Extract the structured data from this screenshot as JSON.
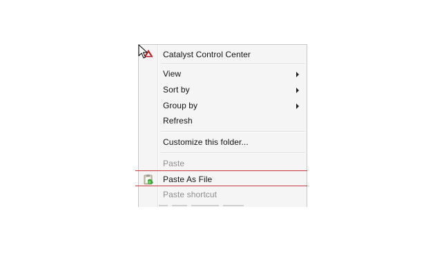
{
  "menu": {
    "items": [
      {
        "label": "Catalyst Control Center",
        "icon": "catalyst-control-center-icon"
      },
      {
        "label": "View",
        "submenu": true
      },
      {
        "label": "Sort by",
        "submenu": true
      },
      {
        "label": "Group by",
        "submenu": true
      },
      {
        "label": "Refresh"
      },
      {
        "label": "Customize this folder..."
      },
      {
        "label": "Paste",
        "disabled": true
      },
      {
        "label": "Paste As File",
        "icon": "paste-as-file-icon",
        "highlighted": true
      },
      {
        "label": "Paste shortcut",
        "disabled": true
      }
    ]
  },
  "colors": {
    "highlight_outline": "#c8373c",
    "menu_background": "#f5f5f5",
    "disabled_text": "#8d8d8d"
  }
}
